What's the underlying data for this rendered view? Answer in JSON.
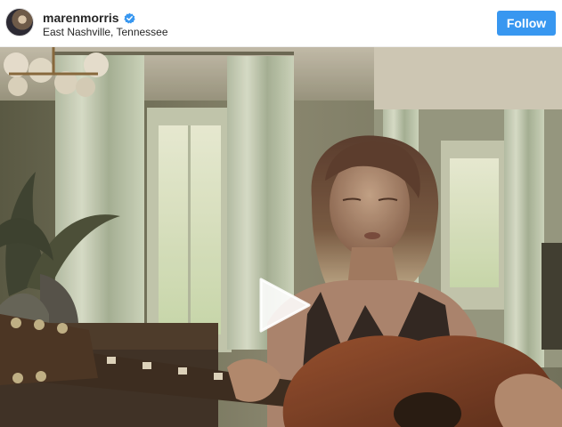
{
  "post": {
    "username": "marenmorris",
    "verified": true,
    "location": "East Nashville, Tennessee",
    "follow_label": "Follow"
  },
  "colors": {
    "accent": "#3897f0",
    "verified_badge": "#3897f0"
  },
  "icons": {
    "verified": "verified-badge-icon",
    "play": "play-icon"
  }
}
